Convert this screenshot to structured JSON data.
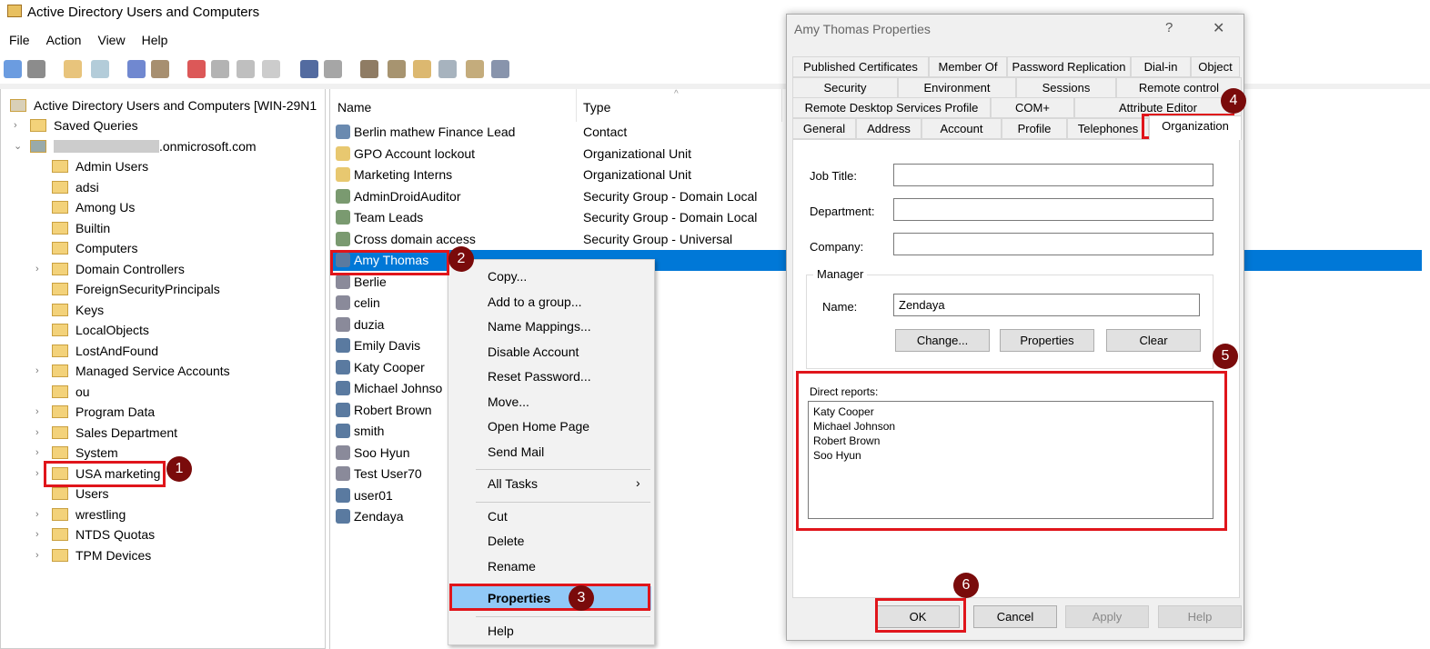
{
  "window": {
    "title": "Active Directory Users and Computers"
  },
  "menu": [
    "File",
    "Action",
    "View",
    "Help"
  ],
  "toolbar_icons": [
    "back-icon",
    "forward-icon",
    "up-folder-icon",
    "console-tree-icon",
    "cut-icon",
    "paste-icon",
    "delete-icon",
    "properties-icon",
    "refresh-icon",
    "export-icon",
    "help-icon",
    "show-pane-icon",
    "new-user-icon",
    "new-group-icon",
    "new-ou-icon",
    "filter-icon",
    "find-icon",
    "add-to-group-icon"
  ],
  "tree": {
    "root": "Active Directory Users and Computers [WIN-29N1",
    "saved": "Saved Queries",
    "domain": ".onmicrosoft.com",
    "items": [
      {
        "label": "Admin Users",
        "exp": false
      },
      {
        "label": "adsi",
        "exp": false
      },
      {
        "label": "Among Us",
        "exp": false
      },
      {
        "label": "Builtin",
        "exp": false
      },
      {
        "label": "Computers",
        "exp": false
      },
      {
        "label": "Domain Controllers",
        "exp": true
      },
      {
        "label": "ForeignSecurityPrincipals",
        "exp": false
      },
      {
        "label": "Keys",
        "exp": false
      },
      {
        "label": "LocalObjects",
        "exp": false
      },
      {
        "label": "LostAndFound",
        "exp": false
      },
      {
        "label": "Managed Service Accounts",
        "exp": true
      },
      {
        "label": "ou",
        "exp": false
      },
      {
        "label": "Program Data",
        "exp": true
      },
      {
        "label": "Sales Department",
        "exp": true
      },
      {
        "label": "System",
        "exp": true
      },
      {
        "label": "USA marketing",
        "exp": true
      },
      {
        "label": "Users",
        "exp": false
      },
      {
        "label": "wrestling",
        "exp": true
      },
      {
        "label": "NTDS Quotas",
        "exp": true
      },
      {
        "label": "TPM Devices",
        "exp": true
      }
    ]
  },
  "list": {
    "headers": [
      "Name",
      "Type"
    ],
    "rows": [
      {
        "name": "Berlin mathew Finance Lead",
        "type": "Contact",
        "kind": "contact"
      },
      {
        "name": "GPO Account lockout",
        "type": "Organizational Unit",
        "kind": "ou"
      },
      {
        "name": "Marketing Interns",
        "type": "Organizational Unit",
        "kind": "ou"
      },
      {
        "name": "AdminDroidAuditor",
        "type": "Security Group - Domain Local",
        "kind": "group"
      },
      {
        "name": "Team Leads",
        "type": "Security Group - Domain Local",
        "kind": "group"
      },
      {
        "name": "Cross domain access",
        "type": "Security Group - Universal",
        "kind": "group"
      },
      {
        "name": "Amy Thomas",
        "type": "",
        "kind": "user"
      },
      {
        "name": "Berlie",
        "type": "",
        "kind": "user-disabled"
      },
      {
        "name": "celin",
        "type": "",
        "kind": "user-disabled"
      },
      {
        "name": "duzia",
        "type": "",
        "kind": "user-disabled"
      },
      {
        "name": "Emily Davis",
        "type": "",
        "kind": "user"
      },
      {
        "name": "Katy Cooper",
        "type": "",
        "kind": "user"
      },
      {
        "name": "Michael Johnso",
        "type": "",
        "kind": "user"
      },
      {
        "name": "Robert Brown",
        "type": "",
        "kind": "user"
      },
      {
        "name": "smith",
        "type": "",
        "kind": "user"
      },
      {
        "name": "Soo Hyun",
        "type": "",
        "kind": "user-disabled"
      },
      {
        "name": "Test User70",
        "type": "",
        "kind": "user-disabled"
      },
      {
        "name": "user01",
        "type": "",
        "kind": "user"
      },
      {
        "name": "Zendaya",
        "type": "",
        "kind": "user"
      }
    ]
  },
  "context_menu": [
    {
      "label": "Copy..."
    },
    {
      "label": "Add to a group..."
    },
    {
      "label": "Name Mappings..."
    },
    {
      "label": "Disable Account"
    },
    {
      "label": "Reset Password..."
    },
    {
      "label": "Move..."
    },
    {
      "label": "Open Home Page"
    },
    {
      "label": "Send Mail"
    },
    {
      "sep": true
    },
    {
      "label": "All Tasks",
      "sub": true
    },
    {
      "sep": true
    },
    {
      "label": "Cut"
    },
    {
      "label": "Delete"
    },
    {
      "label": "Rename"
    },
    {
      "sep": true
    },
    {
      "label": "Properties",
      "bold": true
    },
    {
      "sep": true
    },
    {
      "label": "Help"
    }
  ],
  "dialog": {
    "title": "Amy Thomas Properties",
    "help": "?",
    "close": "✕",
    "tab_rows": [
      [
        "Published Certificates",
        "Member Of",
        "Password Replication",
        "Dial-in",
        "Object"
      ],
      [
        "Security",
        "Environment",
        "Sessions",
        "Remote control"
      ],
      [
        "Remote Desktop Services Profile",
        "COM+",
        "Attribute Editor"
      ],
      [
        "General",
        "Address",
        "Account",
        "Profile",
        "Telephones",
        "Organization"
      ]
    ],
    "active_tab": "Organization",
    "fields": {
      "job_title_label": "Job Title:",
      "job_title": "",
      "department_label": "Department:",
      "department": "",
      "company_label": "Company:",
      "company": ""
    },
    "manager": {
      "group_label": "Manager",
      "name_label": "Name:",
      "name": "Zendaya",
      "change": "Change...",
      "properties": "Properties",
      "clear": "Clear"
    },
    "direct_reports_label": "Direct reports:",
    "direct_reports": [
      "Katy Cooper",
      "Michael Johnson",
      "Robert Brown",
      "Soo Hyun"
    ],
    "buttons": {
      "ok": "OK",
      "cancel": "Cancel",
      "apply": "Apply",
      "help": "Help"
    }
  },
  "steps": [
    "1",
    "2",
    "3",
    "4",
    "5",
    "6"
  ],
  "colors": {
    "selection": "#0078d7",
    "highlight": "#e0151b",
    "badge": "#7a0b0b"
  }
}
